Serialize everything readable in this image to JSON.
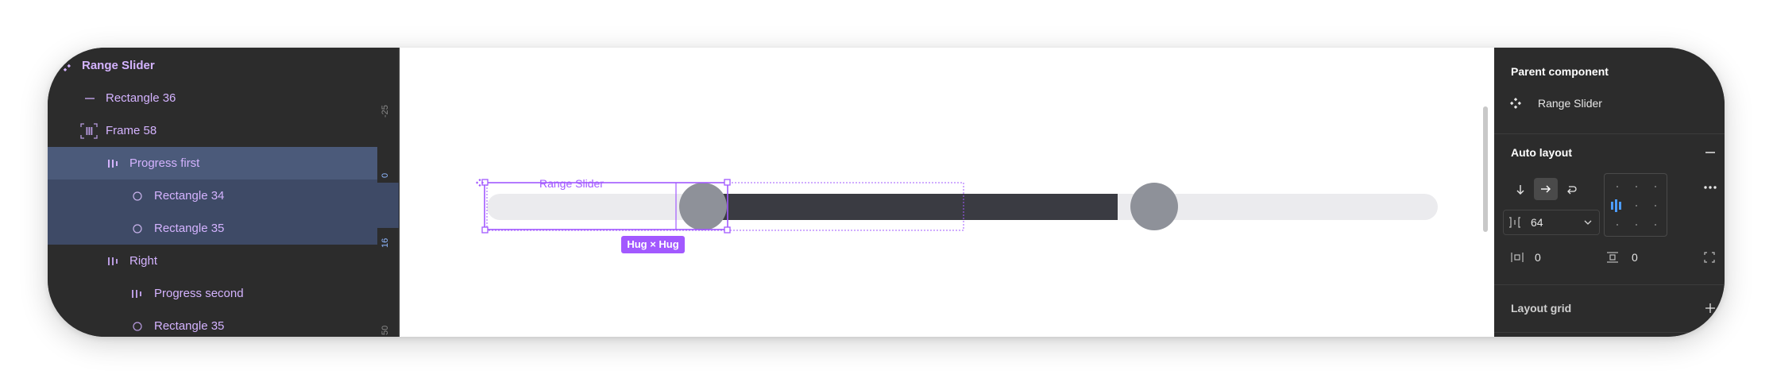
{
  "layers": [
    {
      "label": "Range Slider",
      "icon": "component-icon",
      "level": 0,
      "selected": false
    },
    {
      "label": "Rectangle 36",
      "icon": "line-icon",
      "level": 1,
      "selected": false
    },
    {
      "label": "Frame 58",
      "icon": "frame-autolayout-icon",
      "level": 1,
      "selected": false
    },
    {
      "label": "Progress first",
      "icon": "autolayout-horizontal-icon",
      "level": 2,
      "selected": true
    },
    {
      "label": "Rectangle 34",
      "icon": "ellipse-icon",
      "level": 3,
      "selected": true
    },
    {
      "label": "Rectangle 35",
      "icon": "ellipse-icon",
      "level": 3,
      "selected": true
    },
    {
      "label": "Right",
      "icon": "autolayout-horizontal-icon",
      "level": 2,
      "selected": false
    },
    {
      "label": "Progress second",
      "icon": "autolayout-horizontal-icon",
      "level": 3,
      "selected": false
    },
    {
      "label": "Rectangle 35",
      "icon": "ellipse-icon",
      "level": 3,
      "selected": false
    }
  ],
  "ruler": {
    "ticks": [
      "-25",
      "0",
      "16",
      "50"
    ]
  },
  "canvas": {
    "component_label": "Range Slider",
    "size_badge": "Hug × Hug",
    "track_color": "#ebebee",
    "fill_color": "#3a3b42",
    "thumb_color": "#8e9199",
    "selection_color": "#a259ff"
  },
  "props": {
    "parent_component_title": "Parent component",
    "parent_component_name": "Range Slider",
    "auto_layout_title": "Auto layout",
    "gap_value": "64",
    "padding_horizontal": "0",
    "padding_vertical": "0",
    "layout_grid_title": "Layout grid"
  }
}
